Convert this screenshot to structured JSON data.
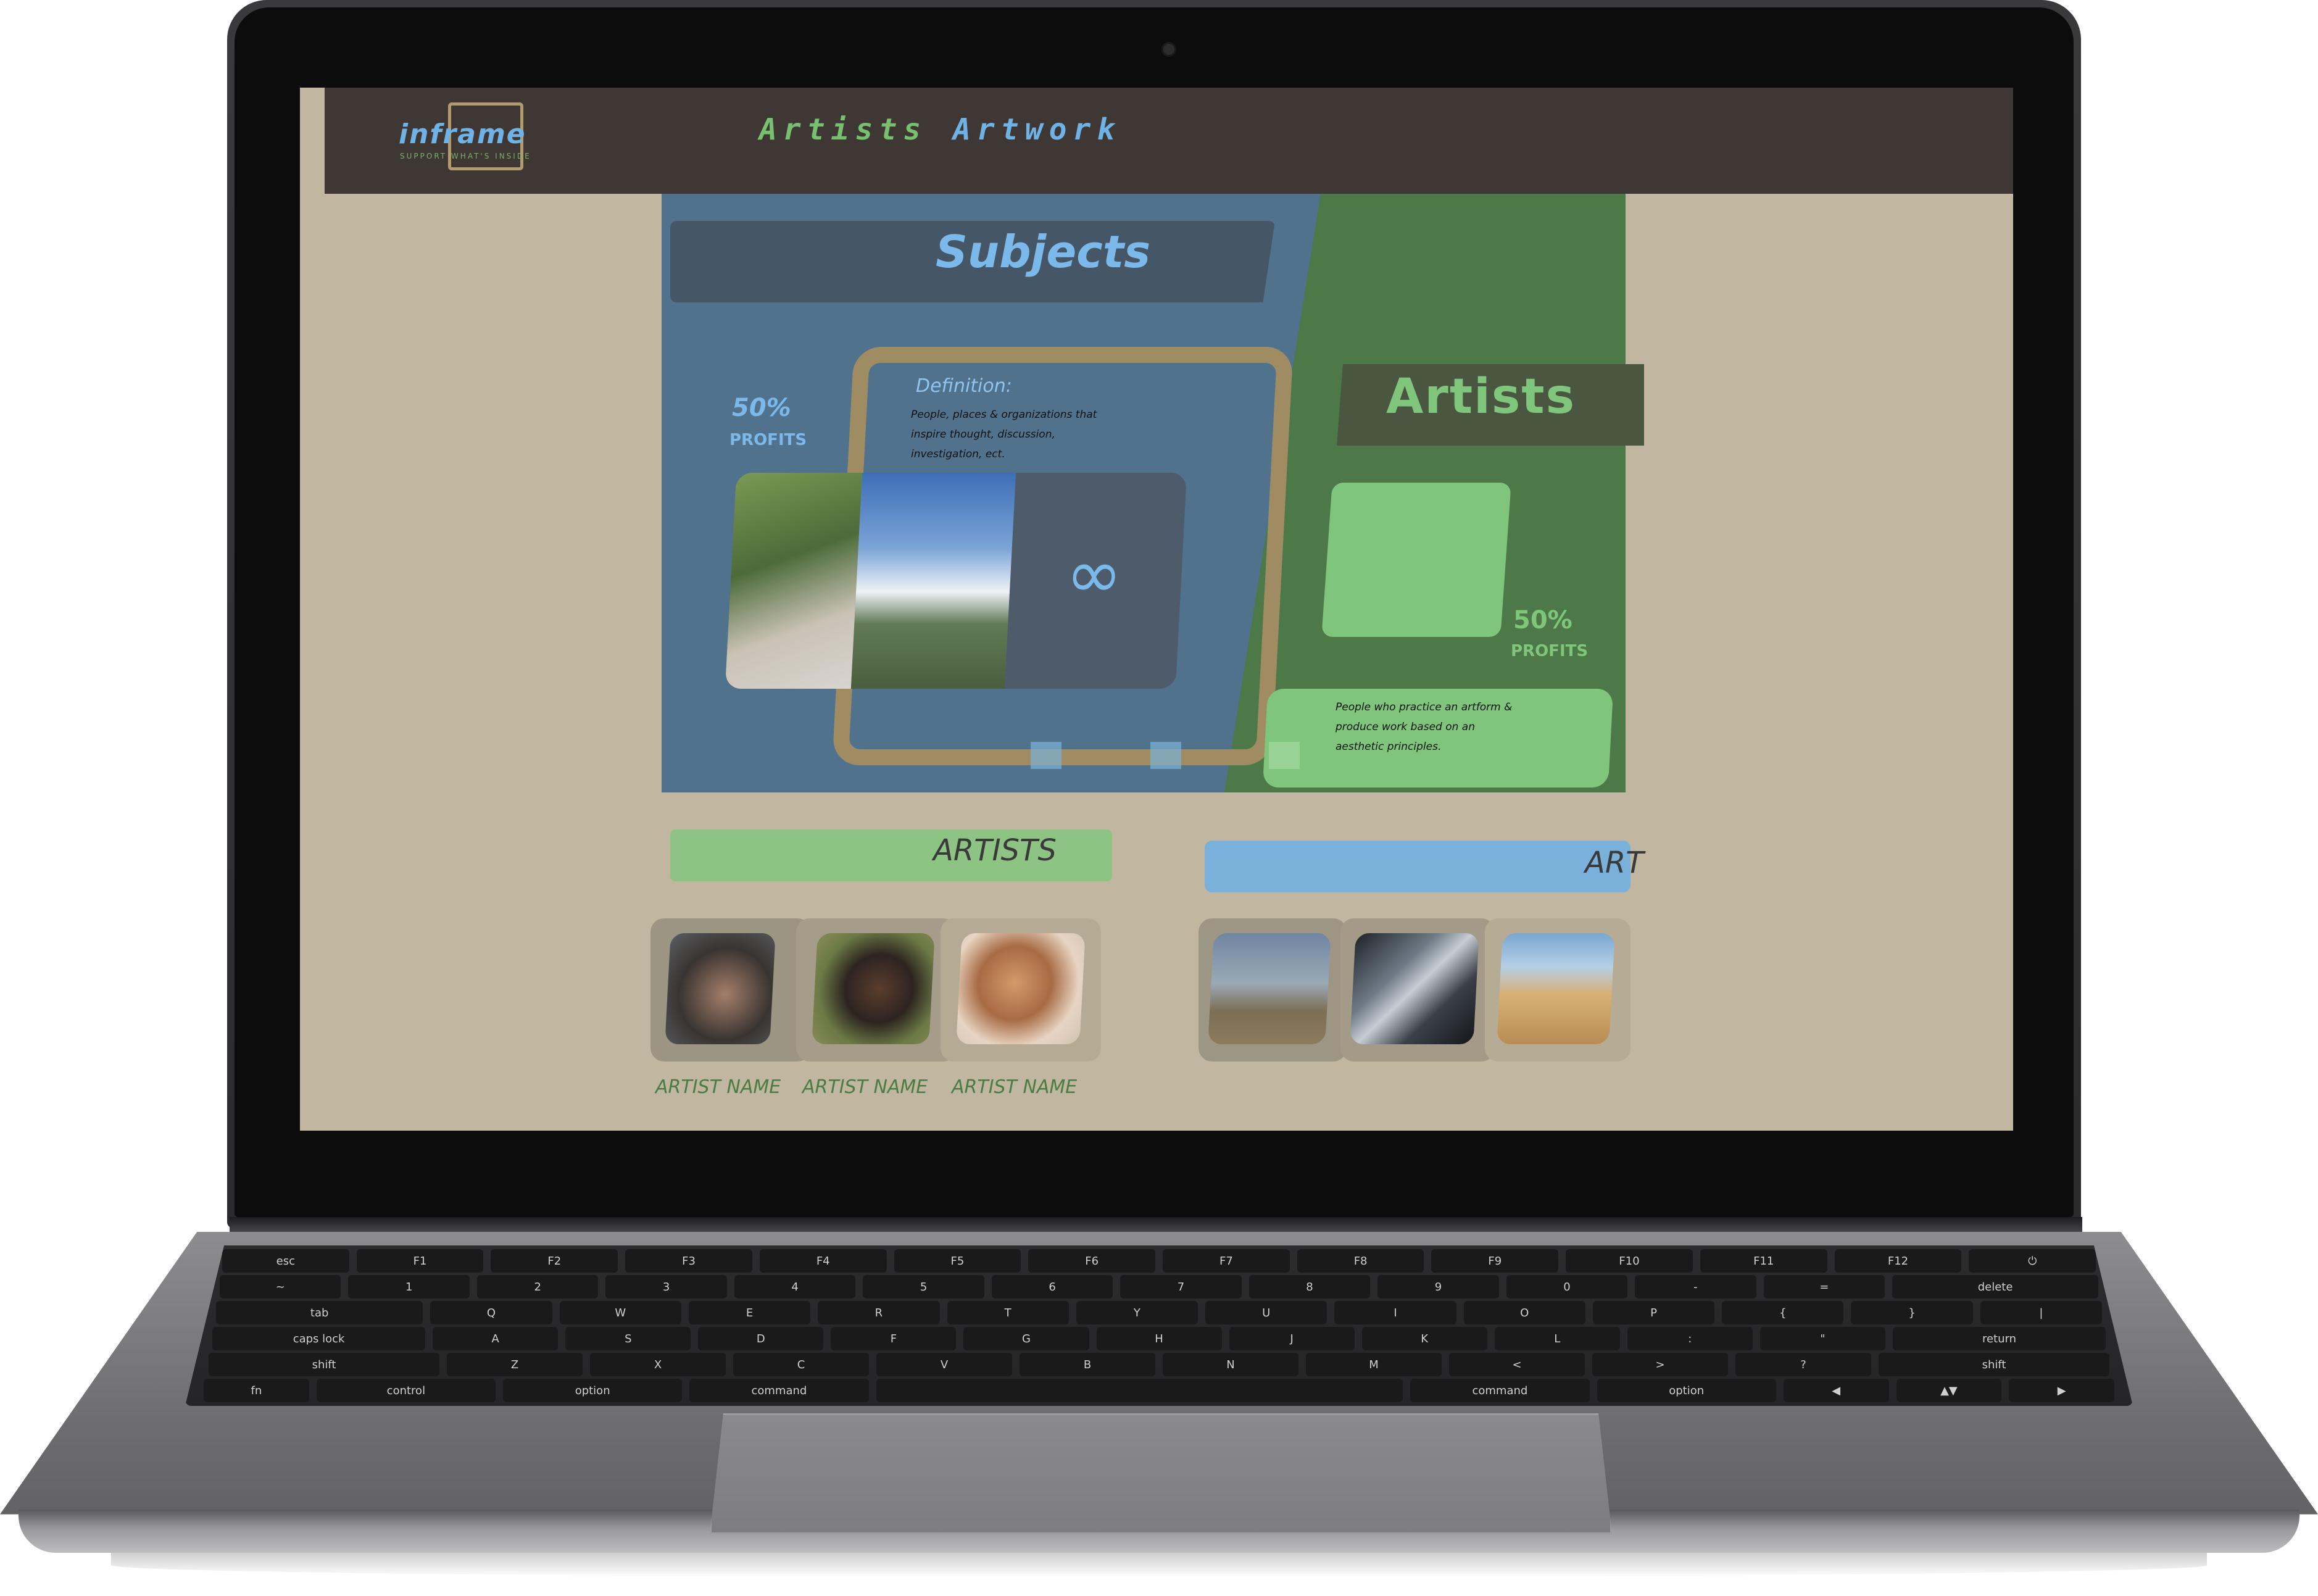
{
  "brand": {
    "logo": "inframe",
    "tagline": "SUPPORT WHAT'S INSIDE"
  },
  "nav": {
    "artists": "Artists",
    "artwork": "Artwork"
  },
  "subjects": {
    "title": "Subjects",
    "definition_title": "Definition:",
    "definition_text": "People, places & organizations that inspire thought, discussion, investigation, ect.",
    "profit_pct": "50%",
    "profit_label": "PROFITS"
  },
  "artists_panel": {
    "title": "Artists",
    "profit_pct": "50%",
    "profit_label": "PROFITS",
    "definition_text": "People who practice an artform & produce work based on an aesthetic principles."
  },
  "sections": {
    "artists_heading": "ARTISTS",
    "art_heading": "ART",
    "artist_names": [
      "ARTIST NAME",
      "ARTIST NAME",
      "ARTIST NAME"
    ]
  },
  "keyboard": {
    "row1": [
      "esc",
      "F1",
      "F2",
      "F3",
      "F4",
      "F5",
      "F6",
      "F7",
      "F8",
      "F9",
      "F10",
      "F11",
      "F12",
      "⏻"
    ],
    "row2": [
      "~",
      "1",
      "2",
      "3",
      "4",
      "5",
      "6",
      "7",
      "8",
      "9",
      "0",
      "-",
      "=",
      "delete"
    ],
    "row3": [
      "tab",
      "Q",
      "W",
      "E",
      "R",
      "T",
      "Y",
      "U",
      "I",
      "O",
      "P",
      "{",
      "}",
      "|"
    ],
    "row4": [
      "caps lock",
      "A",
      "S",
      "D",
      "F",
      "G",
      "H",
      "J",
      "K",
      "L",
      ":",
      "\"",
      "return"
    ],
    "row5": [
      "shift",
      "Z",
      "X",
      "C",
      "V",
      "B",
      "N",
      "M",
      "<",
      ">",
      "?",
      "shift"
    ],
    "row6": [
      "fn",
      "control",
      "option",
      "command",
      "",
      "command",
      "option",
      "◀",
      "▲▼",
      "▶"
    ]
  }
}
